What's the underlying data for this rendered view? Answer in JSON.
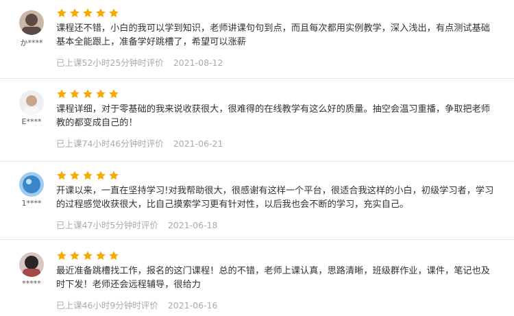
{
  "theme": {
    "star_color": "#f7a900",
    "meta_color": "#aaaaaa",
    "divider_color": "#e6e6e6"
  },
  "reviews": [
    {
      "username": "か****",
      "rating": 5,
      "text": "课程还不错，小白的我可以学到知识，老师讲课句句到点，而且每次都用实例教学，深入浅出，有点测试基础基本全能跟上，准备学好跳槽了，希望可以涨薪",
      "study_time": "已上课52小时25分钟时评价",
      "date": "2021-08-12",
      "avatar_colors": [
        "#5b4a45",
        "#c9b7a6"
      ]
    },
    {
      "username": "E****",
      "rating": 5,
      "text": "课程详细，对于零基础的我来说收获很大，很难得的在线教学有这么好的质量。抽空会温习重播，争取把老师教的都变成自己的！",
      "study_time": "已上课74小时46分钟时评价",
      "date": "2021-06-21",
      "avatar_colors": [
        "#e8e8e8",
        "#c7a58c"
      ]
    },
    {
      "username": "1****",
      "rating": 5,
      "text": "开课以来，一直在坚持学习!对我帮助很大，很感谢有这样一个平台，很适合我这样的小白，初级学习者，学习的过程感觉收获很大，比自己摸索学习更有针对性，以后我也会不断的学习，充实自己。",
      "study_time": "已上课47小时5分钟时评价",
      "date": "2021-06-18",
      "avatar_colors": [
        "#3a86c8",
        "#9ecbee"
      ]
    },
    {
      "username": "*****",
      "rating": 5,
      "text": "最近准备跳槽找工作，报名的这门课程！总的不错，老师上课认真，思路清晰，班级群作业，课件，笔记也及时下发！老师还会远程辅导，很给力",
      "study_time": "已上课46小时9分钟时评价",
      "date": "2021-06-16",
      "avatar_colors": [
        "#2a2424",
        "#a34b48"
      ]
    }
  ]
}
